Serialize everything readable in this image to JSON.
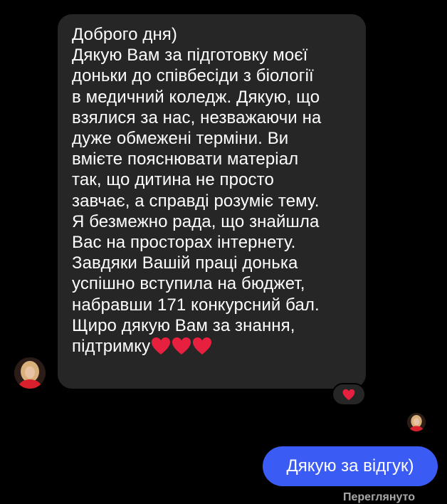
{
  "chat": {
    "incoming_message": "Доброго дня)\nДякую Вам за підготовку моєї\nдоньки до співбесіди з біології\nв медичний коледж. Дякую, що\nвзялися за нас, незважаючи на\nдуже обмежені терміни. Ви\nвмієте пояснювати матеріал\nтак, що дитина не просто\nзавчає, а справді розуміє тему.\nЯ безмежно рада, що знайшла\nВас на просторах інтернету.\nЗавдяки Вашій праці донька\nуспішно вступила на бюджет,\nнабравши 171 конкурсний бал.\nЩиро дякую Вам за знання,\nпідтримку",
    "incoming_hearts": [
      "red-heart-emoji",
      "red-heart-emoji",
      "red-heart-emoji"
    ],
    "reaction": "red-heart-emoji",
    "outgoing_message": "Дякую за відгук)",
    "seen_label": "Переглянуто"
  },
  "colors": {
    "background": "#000000",
    "incoming_bubble": "#262626",
    "outgoing_bubble": "#3b5bf5",
    "heart": "#e8203f",
    "text": "#ffffff"
  }
}
